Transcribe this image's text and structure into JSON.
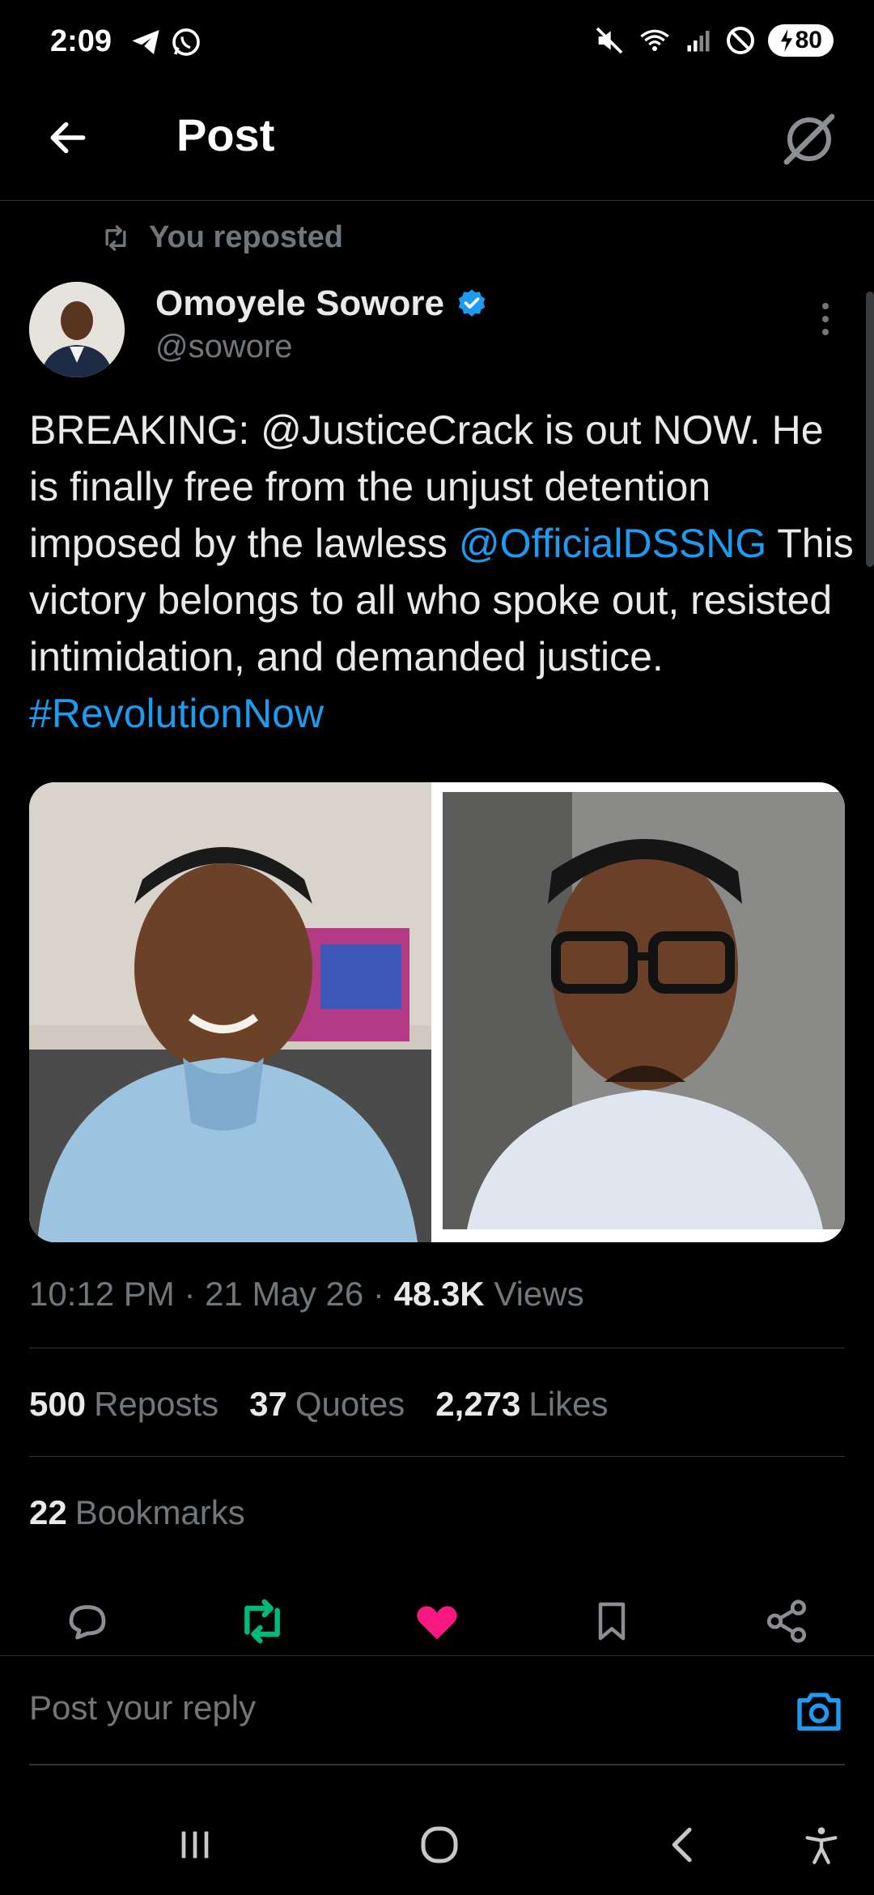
{
  "status_bar": {
    "time": "2:09",
    "battery": "80"
  },
  "header": {
    "title": "Post"
  },
  "repost": {
    "label": "You reposted"
  },
  "author": {
    "name": "Omoyele Sowore",
    "handle": "@sowore",
    "verified": true
  },
  "post": {
    "text_part1": "BREAKING: @JusticeCrack is out NOW. He is finally free from the unjust detention imposed by the lawless ",
    "mention_link": "@OfficialDSSNG",
    "text_part2": " This victory belongs to all who spoke out, resisted intimidation, and demanded justice. ",
    "hashtag_link": "#RevolutionNow"
  },
  "meta": {
    "time": "10:12 PM",
    "date": "21 May 26",
    "views_count": "48.3K",
    "views_label": "Views"
  },
  "stats": {
    "reposts_count": "500",
    "reposts_label": "Reposts",
    "quotes_count": "37",
    "quotes_label": "Quotes",
    "likes_count": "2,273",
    "likes_label": "Likes",
    "bookmarks_count": "22",
    "bookmarks_label": "Bookmarks"
  },
  "reply": {
    "placeholder": "Post your reply"
  },
  "colors": {
    "link": "#1d9bf0",
    "repost_active": "#00ba7c",
    "like_active": "#f91880",
    "muted": "#71767b"
  }
}
